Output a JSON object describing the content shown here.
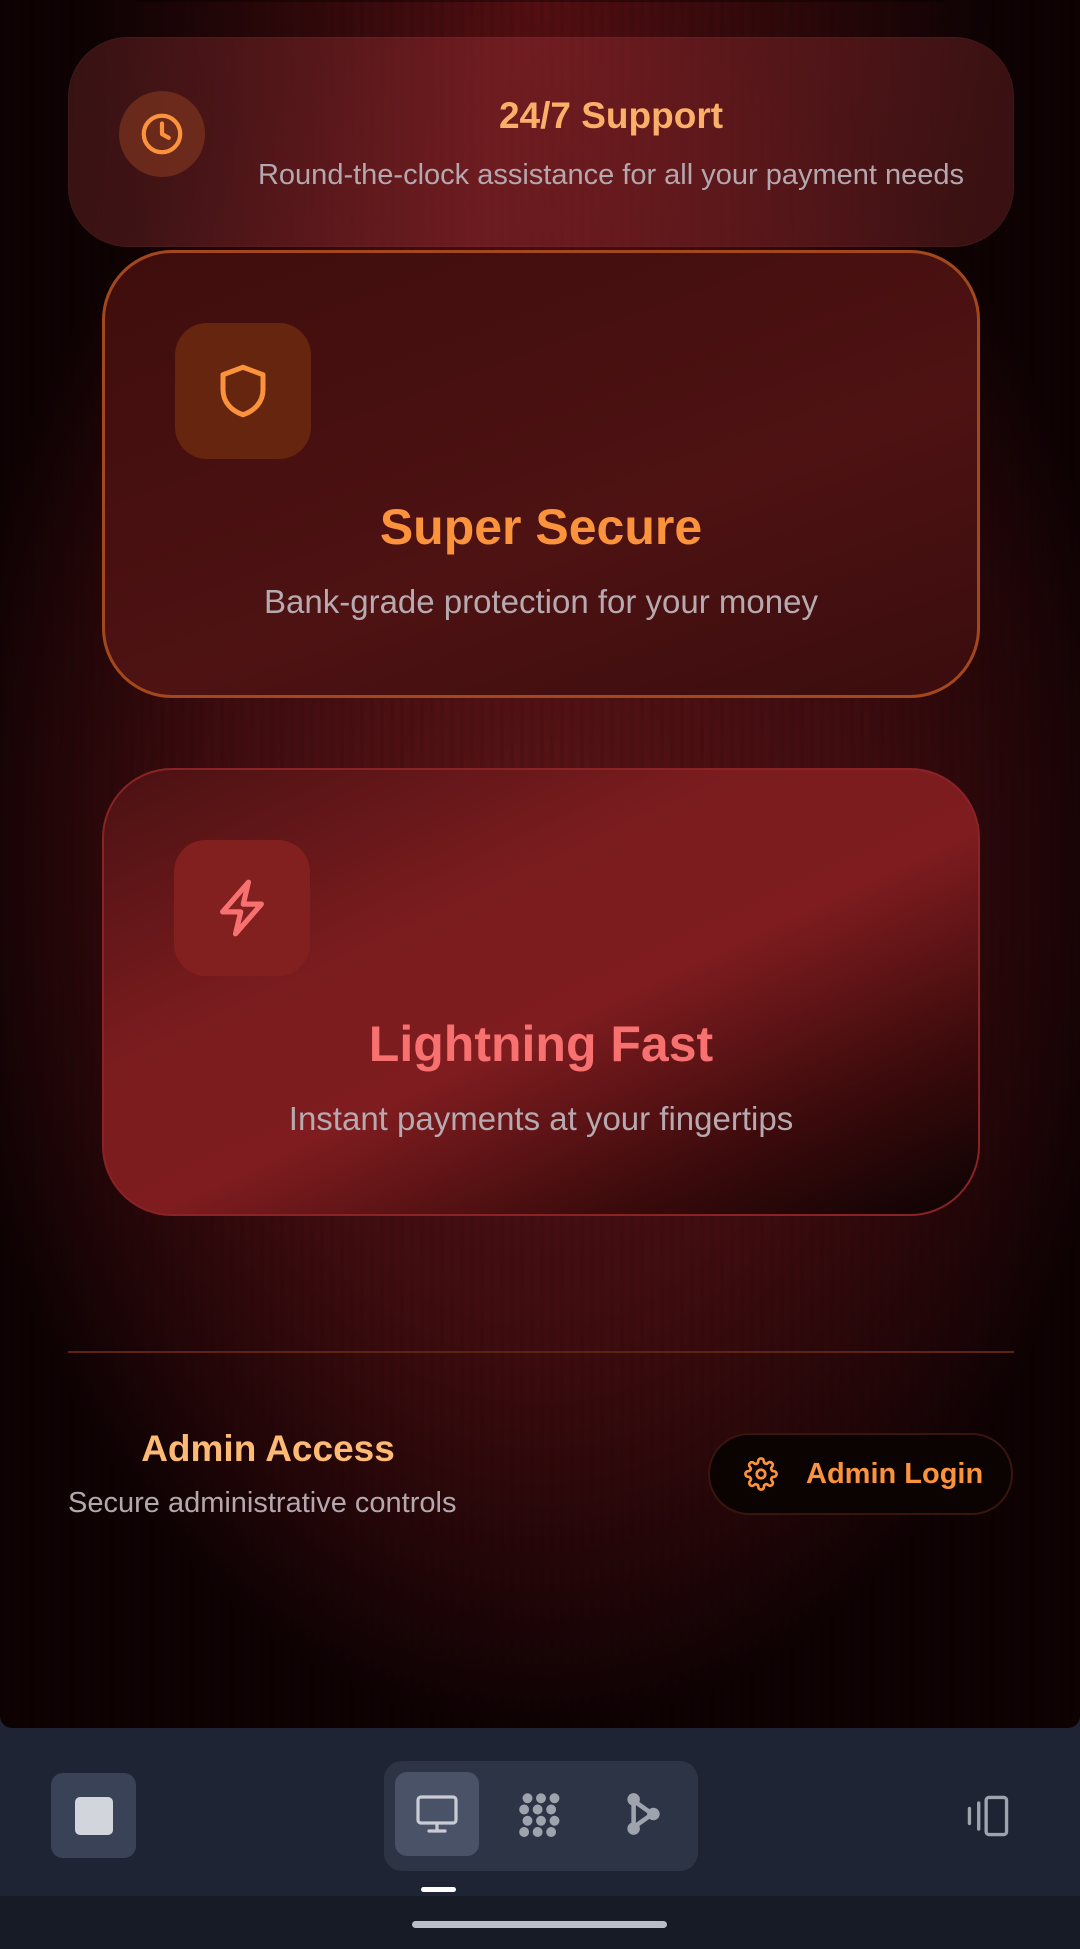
{
  "support": {
    "title": "24/7 Support",
    "description": "Round-the-clock assistance for all your payment needs",
    "icon": "clock-icon"
  },
  "features": {
    "secure": {
      "title": "Super Secure",
      "description": "Bank-grade protection for your money",
      "icon": "shield-icon"
    },
    "fast": {
      "title": "Lightning Fast",
      "description": "Instant payments at your fingertips",
      "icon": "lightning-icon"
    }
  },
  "admin": {
    "title": "Admin Access",
    "subtitle": "Secure administrative controls",
    "button_label": "Admin Login",
    "button_icon": "gear-icon"
  },
  "system_bar": {
    "left": "stop-icon",
    "modes": [
      "desktop-icon",
      "grid-dots-icon",
      "share-nodes-icon"
    ],
    "active_mode": "desktop-icon",
    "right": "rotate-device-icon"
  },
  "colors": {
    "accent_orange": "#fb923c",
    "accent_red": "#f87171",
    "support_title": "#fbb06a",
    "muted_text": "#b4a8ae",
    "background_dark": "#3e0c0f"
  }
}
